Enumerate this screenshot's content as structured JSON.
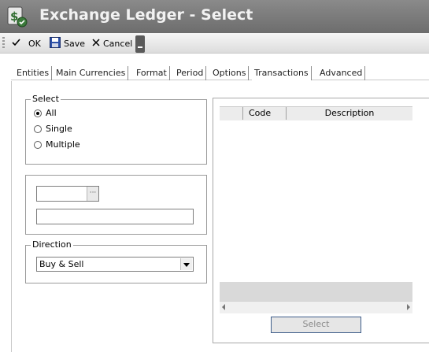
{
  "window": {
    "title": "Exchange Ledger - Select",
    "icon": "ledger-app-icon"
  },
  "toolbar": {
    "ok_label": "OK",
    "save_label": "Save",
    "cancel_label": "Cancel"
  },
  "tabs": [
    {
      "label": "Entities"
    },
    {
      "label": "Main Currencies"
    },
    {
      "label": "Format"
    },
    {
      "label": "Period"
    },
    {
      "label": "Options"
    },
    {
      "label": "Transactions",
      "active": true
    },
    {
      "label": "Advanced"
    }
  ],
  "select_group": {
    "legend": "Select",
    "options": [
      {
        "label": "All",
        "checked": true
      },
      {
        "label": "Single",
        "checked": false
      },
      {
        "label": "Multiple",
        "checked": false
      }
    ]
  },
  "lookup": {
    "code_value": "",
    "description_value": ""
  },
  "direction": {
    "legend": "Direction",
    "selected": "Buy & Sell"
  },
  "grid": {
    "columns": [
      "Code",
      "Description"
    ],
    "rows": []
  },
  "select_button_label": "Select",
  "colors": {
    "titlebar": "#7a7a7a",
    "title_text": "#f2f2f2",
    "select_button_border": "#3e5d8a"
  }
}
